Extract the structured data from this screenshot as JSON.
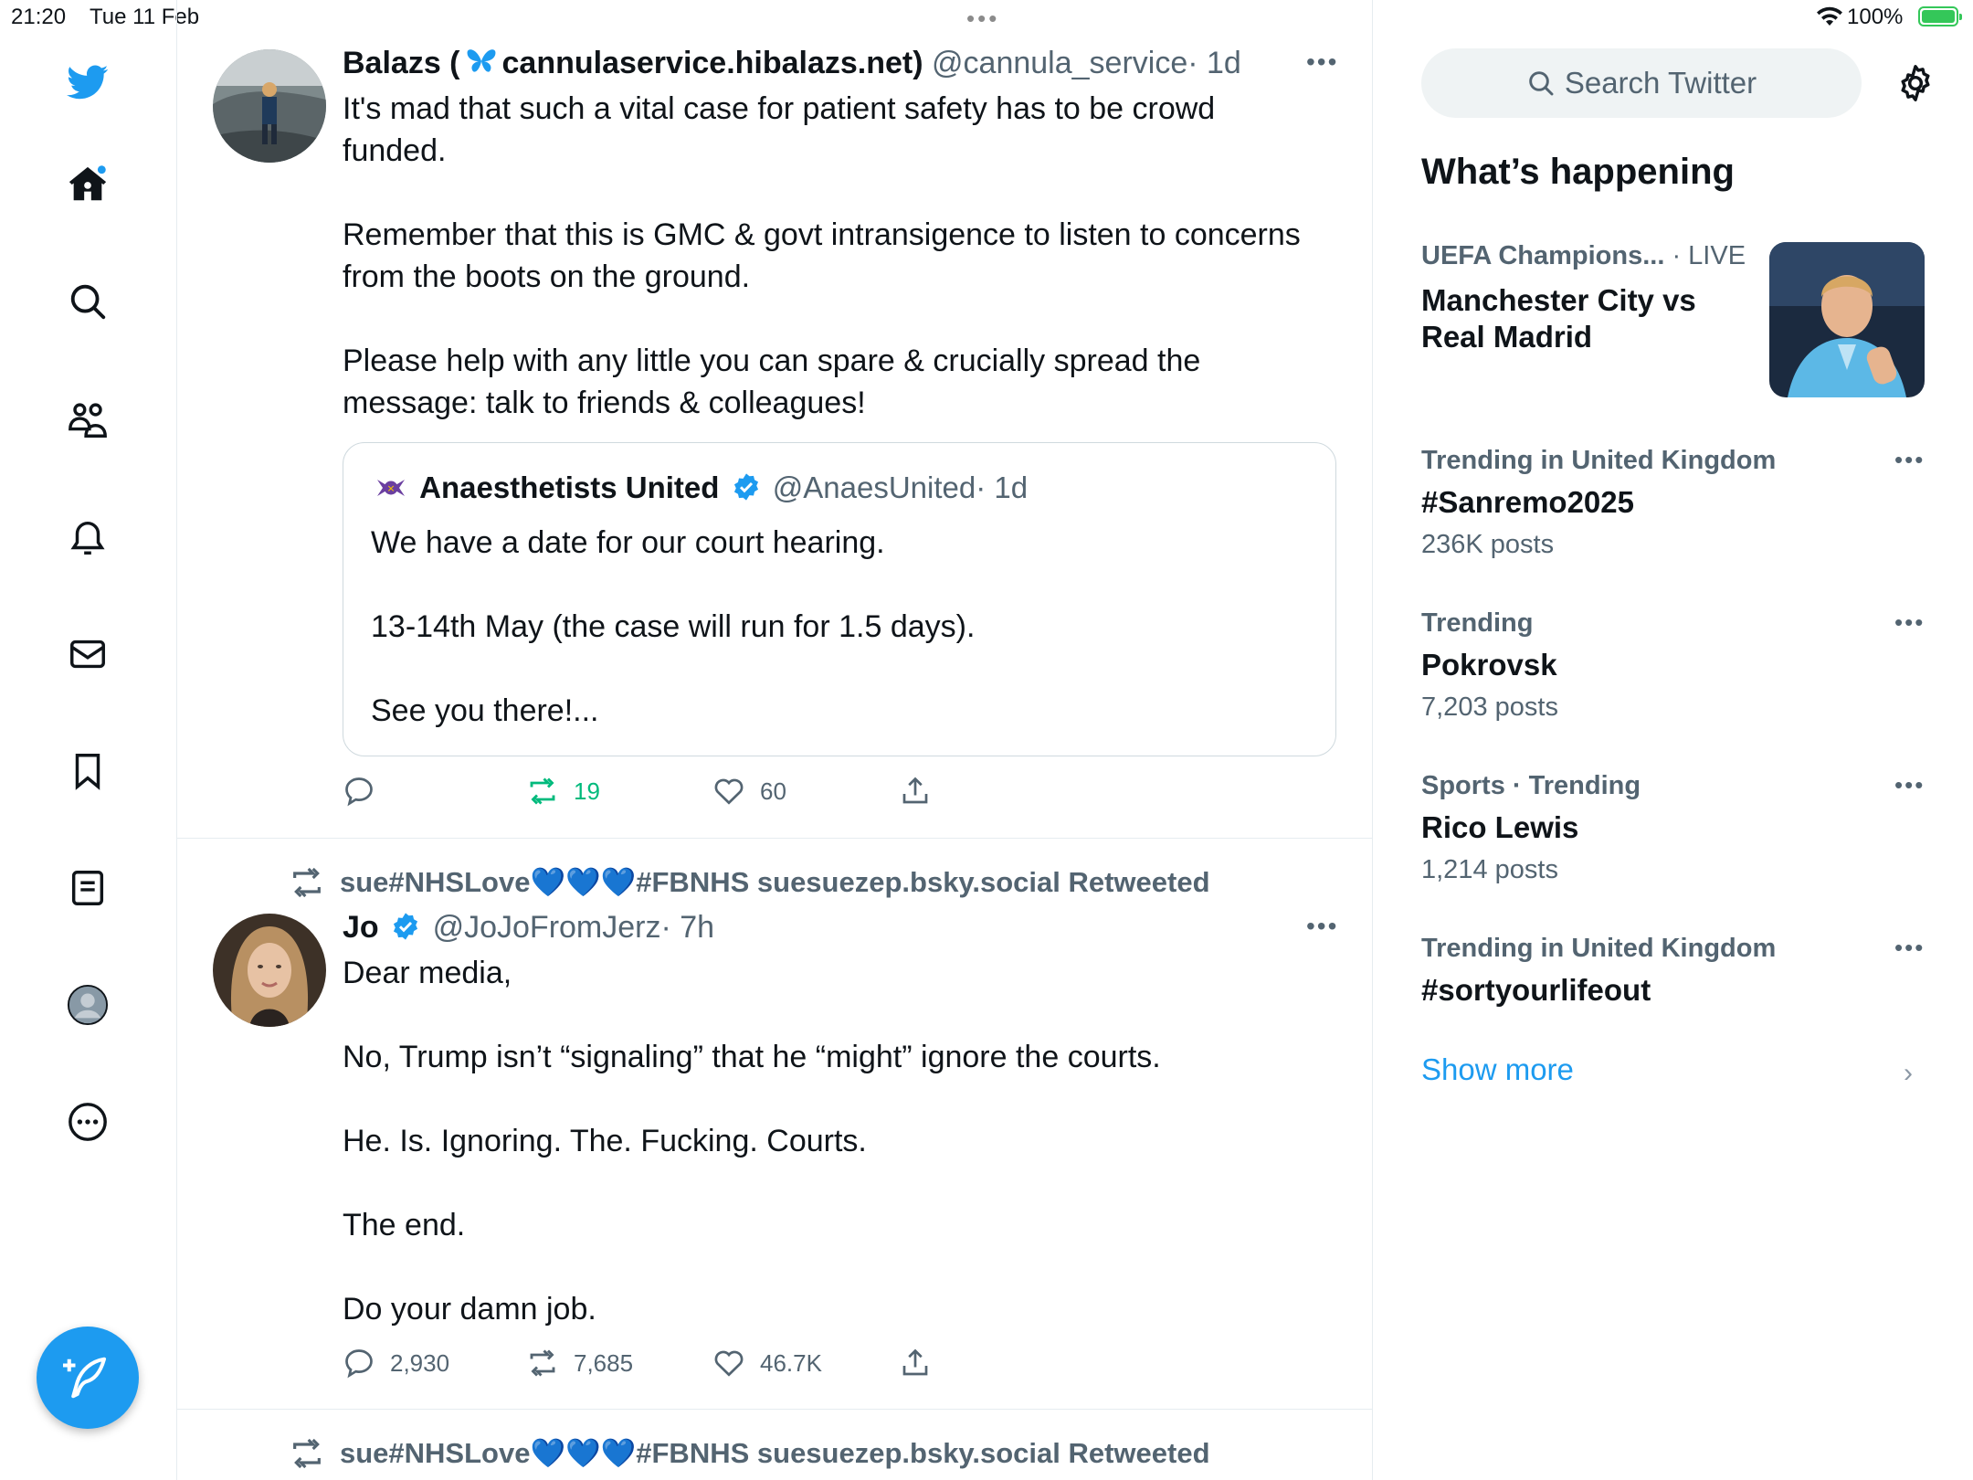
{
  "status_bar": {
    "time": "21:20",
    "date": "Tue 11 Feb",
    "battery": "100%"
  },
  "nav": {
    "items": [
      "twitter-logo",
      "home",
      "explore",
      "communities",
      "notifications",
      "messages",
      "bookmarks",
      "lists",
      "profile",
      "more"
    ],
    "compose_label": "compose"
  },
  "tweets": [
    {
      "name": "Balazs (",
      "name_after_emoji": "cannulaservice.hibalazs.net)",
      "handle": "@cannula_service",
      "time": "· 1d",
      "text": "It's mad that such a vital case for patient safety has to be crowd\nfunded.\n\nRemember that this is GMC & govt intransigence to listen to concerns\nfrom the boots on the ground.\n\nPlease help with any little you can spare & crucially spread the\nmessage: talk to friends & colleagues!",
      "quote": {
        "name": "Anaesthetists United",
        "handle": "@AnaesUnited",
        "time": "· 1d",
        "text": "We have a date for our court hearing.\n\n13-14th May (the case will run for 1.5 days).\n\nSee you there!..."
      },
      "replies": "",
      "retweets": "19",
      "likes": "60"
    },
    {
      "retweeted_by": "sue#NHSLove💙💙💙#FBNHS suesuezep.bsky.social Retweeted",
      "name": "Jo",
      "handle": "@JoJoFromJerz",
      "time": "· 7h",
      "text": "Dear media,\n\nNo, Trump isn’t “signaling” that he “might” ignore the courts.\n\nHe. Is. Ignoring. The. Fucking. Courts.\n\nThe end.\n\nDo your damn job.",
      "replies": "2,930",
      "retweets": "7,685",
      "likes": "46.7K"
    },
    {
      "retweeted_by": "sue#NHSLove💙💙💙#FBNHS suesuezep.bsky.social Retweeted"
    }
  ],
  "sidebar": {
    "search_placeholder": "Search Twitter",
    "title": "What’s happening",
    "featured": {
      "category": "UEFA Champions...",
      "live": "· LIVE",
      "title": "Manchester City vs\nReal Madrid"
    },
    "trends": [
      {
        "category": "Trending in United Kingdom",
        "name": "#Sanremo2025",
        "count": "236K posts"
      },
      {
        "category": "Trending",
        "name": "Pokrovsk",
        "count": "7,203 posts"
      },
      {
        "category": "Sports · Trending",
        "name": "Rico Lewis",
        "count": "1,214 posts"
      },
      {
        "category": "Trending in United Kingdom",
        "name": "#sortyourlifeout",
        "count": ""
      }
    ],
    "show_more": "Show more"
  },
  "colors": {
    "accent": "#1d9bf0",
    "retweet_green": "#00ba7c",
    "secondary_text": "#536471"
  }
}
